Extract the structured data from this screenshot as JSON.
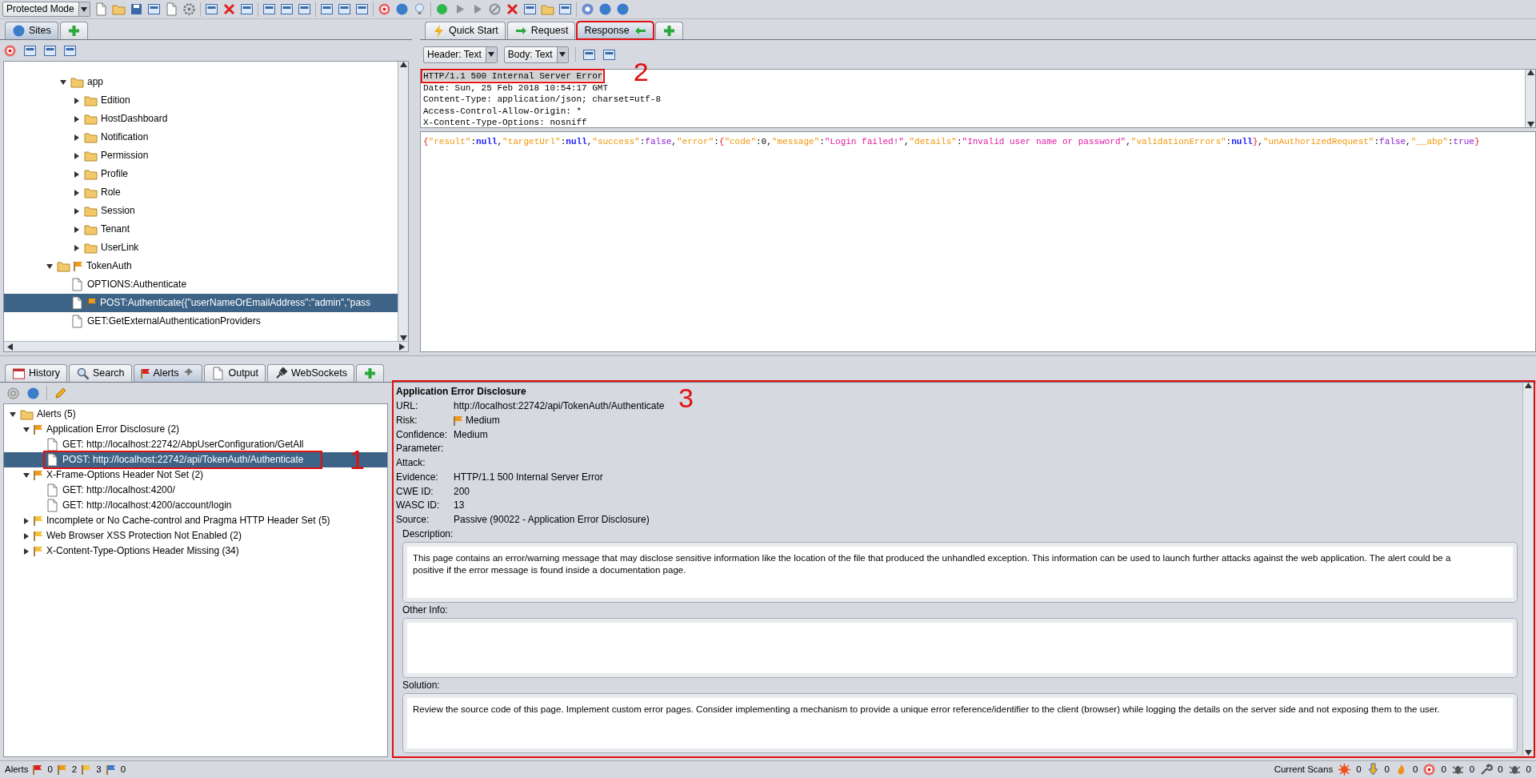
{
  "toolbar": {
    "mode_select": "Protected Mode"
  },
  "sites_panel": {
    "tabs": [
      {
        "label": "Sites",
        "selected": true
      }
    ],
    "tree": [
      {
        "children": [
          {
            "label": "app",
            "kind": "folder",
            "expanded": true,
            "flagged": false,
            "selected": false,
            "children": [
              {
                "label": "Edition",
                "kind": "folder",
                "expanded": false,
                "flagged": false,
                "selected": false
              },
              {
                "label": "HostDashboard",
                "kind": "folder",
                "expanded": false,
                "flagged": false,
                "selected": false
              },
              {
                "label": "Notification",
                "kind": "folder",
                "expanded": false,
                "flagged": false,
                "selected": false
              },
              {
                "label": "Permission",
                "kind": "folder",
                "expanded": false,
                "flagged": false,
                "selected": false
              },
              {
                "label": "Profile",
                "kind": "folder",
                "expanded": false,
                "flagged": false,
                "selected": false
              },
              {
                "label": "Role",
                "kind": "folder",
                "expanded": false,
                "flagged": false,
                "selected": false
              },
              {
                "label": "Session",
                "kind": "folder",
                "expanded": false,
                "flagged": false,
                "selected": false
              },
              {
                "label": "Tenant",
                "kind": "folder",
                "expanded": false,
                "flagged": false,
                "selected": false
              },
              {
                "label": "UserLink",
                "kind": "folder",
                "expanded": false,
                "flagged": false,
                "selected": false
              }
            ]
          }
        ]
      },
      {
        "label": "TokenAuth",
        "kind": "folder",
        "expanded": true,
        "flagged": true,
        "selected": false,
        "children": [
          {
            "label": "OPTIONS:Authenticate",
            "kind": "page",
            "flagged": false,
            "selected": false
          },
          {
            "label": "POST:Authenticate({\"userNameOrEmailAddress\":\"admin\",\"pass",
            "kind": "page",
            "flagged": true,
            "selected": true
          },
          {
            "label": "GET:GetExternalAuthenticationProviders",
            "kind": "page",
            "flagged": false,
            "selected": false
          }
        ]
      }
    ]
  },
  "message_panel": {
    "tabs": [
      {
        "label": "Quick Start",
        "selected": false,
        "highlighted": false
      },
      {
        "label": "Request",
        "selected": false,
        "highlighted": false
      },
      {
        "label": "Response",
        "selected": true,
        "highlighted": true
      }
    ],
    "header_view": "Header: Text",
    "body_view": "Body: Text",
    "header_lines": [
      {
        "text": "HTTP/1.1 500 Internal Server Error",
        "annotation": "2"
      },
      {
        "text": "Date: Sun, 25 Feb 2018 10:54:17 GMT"
      },
      {
        "text": "Content-Type: application/json; charset=utf-8"
      },
      {
        "text": "Access-Control-Allow-Origin: *"
      },
      {
        "text": "X-Content-Type-Options: nosniff"
      }
    ],
    "body_tokens": [
      {
        "text": "{",
        "kind": "brace"
      },
      {
        "text": "\"result\"",
        "kind": "key"
      },
      {
        "text": ":",
        "kind": "punct"
      },
      {
        "text": "null",
        "kind": "null"
      },
      {
        "text": ",",
        "kind": "punct"
      },
      {
        "text": "\"targetUrl\"",
        "kind": "key"
      },
      {
        "text": ":",
        "kind": "punct"
      },
      {
        "text": "null",
        "kind": "null"
      },
      {
        "text": ",",
        "kind": "punct"
      },
      {
        "text": "\"success\"",
        "kind": "key"
      },
      {
        "text": ":",
        "kind": "punct"
      },
      {
        "text": "false",
        "kind": "bool"
      },
      {
        "text": ",",
        "kind": "punct"
      },
      {
        "text": "\"error\"",
        "kind": "key"
      },
      {
        "text": ":",
        "kind": "punct"
      },
      {
        "text": "{",
        "kind": "brace"
      },
      {
        "text": "\"code\"",
        "kind": "key"
      },
      {
        "text": ":",
        "kind": "punct"
      },
      {
        "text": "0",
        "kind": "number"
      },
      {
        "text": ",",
        "kind": "punct"
      },
      {
        "text": "\"message\"",
        "kind": "key"
      },
      {
        "text": ":",
        "kind": "punct"
      },
      {
        "text": "\"Login failed!\"",
        "kind": "string"
      },
      {
        "text": ",",
        "kind": "punct"
      },
      {
        "text": "\"details\"",
        "kind": "key"
      },
      {
        "text": ":",
        "kind": "punct"
      },
      {
        "text": "\"Invalid user name or password\"",
        "kind": "string"
      },
      {
        "text": ",",
        "kind": "punct"
      },
      {
        "text": "\"validationErrors\"",
        "kind": "key"
      },
      {
        "text": ":",
        "kind": "punct"
      },
      {
        "text": "null",
        "kind": "null"
      },
      {
        "text": "}",
        "kind": "brace"
      },
      {
        "text": ",",
        "kind": "punct"
      },
      {
        "text": "\"unAuthorizedRequest\"",
        "kind": "key"
      },
      {
        "text": ":",
        "kind": "punct"
      },
      {
        "text": "false",
        "kind": "bool"
      },
      {
        "text": ",",
        "kind": "punct"
      },
      {
        "text": "\"__abp\"",
        "kind": "key"
      },
      {
        "text": ":",
        "kind": "punct"
      },
      {
        "text": "true",
        "kind": "bool"
      },
      {
        "text": "}",
        "kind": "brace"
      }
    ]
  },
  "bottom_tabs": [
    {
      "label": "History",
      "selected": false,
      "pinned": false
    },
    {
      "label": "Search",
      "selected": false,
      "pinned": false
    },
    {
      "label": "Alerts",
      "selected": true,
      "pinned": true
    },
    {
      "label": "Output",
      "selected": false,
      "pinned": false
    },
    {
      "label": "WebSockets",
      "selected": false,
      "pinned": false
    }
  ],
  "alerts_tree": {
    "label": "Alerts (5)",
    "expanded": true,
    "children": [
      {
        "label": "Application Error Disclosure (2)",
        "color": "#f09a1a",
        "expanded": true,
        "children": [
          {
            "label": "GET: http://localhost:22742/AbpUserConfiguration/GetAll",
            "selected": false
          },
          {
            "label": "POST: http://localhost:22742/api/TokenAuth/Authenticate",
            "selected": true,
            "annotation": "1"
          }
        ]
      },
      {
        "label": "X-Frame-Options Header Not Set (2)",
        "color": "#f09a1a",
        "expanded": true,
        "children": [
          {
            "label": "GET: http://localhost:4200/",
            "selected": false
          },
          {
            "label": "GET: http://localhost:4200/account/login",
            "selected": false
          }
        ]
      },
      {
        "label": "Incomplete or No Cache-control and Pragma HTTP Header Set (5)",
        "color": "#f2c23a",
        "expanded": false
      },
      {
        "label": "Web Browser XSS Protection Not Enabled (2)",
        "color": "#f2c23a",
        "expanded": false
      },
      {
        "label": "X-Content-Type-Options Header Missing (34)",
        "color": "#f2c23a",
        "expanded": false
      }
    ]
  },
  "alert_details": {
    "annotation": "3",
    "title": "Application Error Disclosure",
    "fields": [
      {
        "label": "URL:",
        "value": "http://localhost:22742/api/TokenAuth/Authenticate"
      },
      {
        "label": "Risk:",
        "value": "Medium",
        "kind": "risk",
        "color": "#f09a1a"
      },
      {
        "label": "Confidence:",
        "value": "Medium"
      },
      {
        "label": "Parameter:"
      },
      {
        "label": "Attack:"
      },
      {
        "label": "Evidence:",
        "value": "HTTP/1.1 500 Internal Server Error"
      },
      {
        "label": "CWE ID:",
        "value": "200"
      },
      {
        "label": "WASC ID:",
        "value": "13"
      },
      {
        "label": "Source:",
        "value": "Passive (90022 - Application Error Disclosure)"
      }
    ],
    "sections": [
      {
        "label": "Description:",
        "text": "This page contains an error/warning message that may disclose sensitive information like the location of the file that produced the unhandled exception. This information can be used to launch further attacks against the web application. The alert could be a\npositive if the error message is found inside a documentation page."
      },
      {
        "label": "Other Info:"
      },
      {
        "label": "Solution:",
        "text": "Review the source code of this page. Implement custom error pages. Consider implementing a mechanism to provide a unique error reference/identifier to the client (browser) while logging the details on the server side and not exposing them to the user."
      }
    ]
  },
  "status_bar": {
    "alerts_label": "Alerts",
    "alert_counts": [
      {
        "count": "0",
        "color": "#e02020"
      },
      {
        "count": "2",
        "color": "#f09a1a"
      },
      {
        "count": "3",
        "color": "#f2c23a"
      },
      {
        "count": "0",
        "color": "#3a7ad0"
      }
    ],
    "scans_label": "Current Scans",
    "scan_counts": [
      "0",
      "0",
      "0",
      "0",
      "0",
      "0",
      "0"
    ]
  }
}
